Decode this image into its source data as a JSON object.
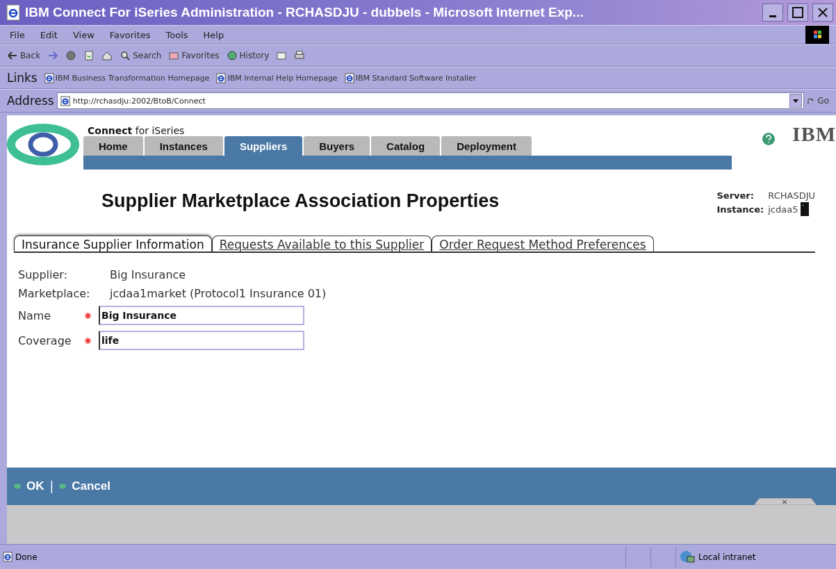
{
  "window": {
    "title": "IBM Connect For iSeries Administration - RCHASDJU - dubbels - Microsoft Internet Exp..."
  },
  "menu": [
    "File",
    "Edit",
    "View",
    "Favorites",
    "Tools",
    "Help"
  ],
  "toolbar": [
    {
      "kind": "back",
      "label": "Back"
    },
    {
      "kind": "forward"
    },
    {
      "kind": "stop"
    },
    {
      "kind": "refresh"
    },
    {
      "kind": "home"
    },
    {
      "kind": "search",
      "label": "Search"
    },
    {
      "kind": "favorites",
      "label": "Favorites"
    },
    {
      "kind": "history",
      "label": "History"
    },
    {
      "kind": "mail"
    },
    {
      "kind": "print"
    }
  ],
  "links": {
    "label": "Links",
    "items": [
      "IBM Business Transformation Homepage",
      "IBM Internal Help Homepage",
      "IBM Standard Software Installer"
    ]
  },
  "address": {
    "label": "Address",
    "value": "http://rchasdju:2002/BtoB/Connect",
    "go": "Go"
  },
  "page": {
    "brand": {
      "bold": "Connect",
      "rest": "for iSeries"
    },
    "logo": "IBM",
    "tabs": [
      {
        "label": "Home",
        "selected": false
      },
      {
        "label": "Instances",
        "selected": false
      },
      {
        "label": "Suppliers",
        "selected": true
      },
      {
        "label": "Buyers",
        "selected": false
      },
      {
        "label": "Catalog",
        "selected": false
      },
      {
        "label": "Deployment",
        "selected": false
      }
    ],
    "title": "Supplier Marketplace Association Properties",
    "server": {
      "label": "Server:",
      "value": "RCHASDJU"
    },
    "instance": {
      "label": "Instance:",
      "value": "jcdaa5"
    },
    "subtabs": [
      {
        "label": "Insurance Supplier Information",
        "selected": true
      },
      {
        "label": "Requests Available to this Supplier",
        "selected": false
      },
      {
        "label": "Order Request Method Preferences",
        "selected": false
      }
    ],
    "info": [
      {
        "label": "Supplier:",
        "value": "Big Insurance"
      },
      {
        "label": "Marketplace:",
        "value": "jcdaa1market (Protocol1 Insurance 01)"
      }
    ],
    "fields": [
      {
        "label": "Name",
        "required": true,
        "value": "Big Insurance"
      },
      {
        "label": "Coverage",
        "required": true,
        "value": "life"
      }
    ],
    "actions": [
      "OK",
      "Cancel"
    ],
    "separator": "|"
  },
  "status_bar": {
    "text": "Done",
    "zone": "Local intranet"
  }
}
